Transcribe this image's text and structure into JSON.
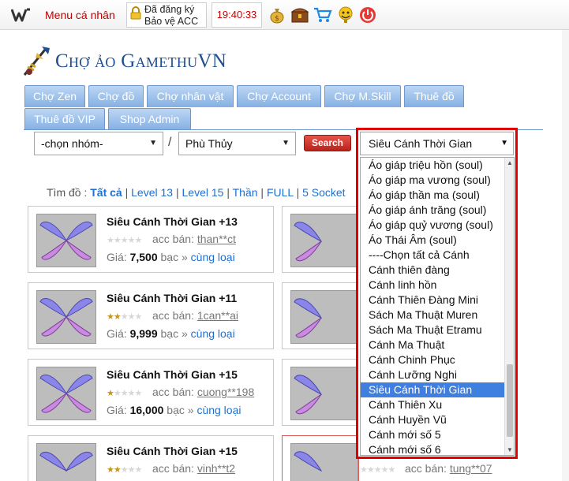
{
  "topbar": {
    "menu_label": "Menu cá nhân",
    "register_line1": "Đã đăng ký",
    "register_line2": "Bảo vệ ACC",
    "clock": "19:40:33",
    "icons": [
      "money-bag-icon",
      "chest-icon",
      "cart-icon",
      "trophy-icon",
      "power-icon"
    ]
  },
  "header": {
    "title": "Chợ ảo GamethuVN"
  },
  "tabs": [
    "Chợ Zen",
    "Chợ đồ",
    "Chợ nhân vật",
    "Chợ Account",
    "Chợ M.Skill",
    "Thuê đồ",
    "Thuê đồ VIP",
    "Shop Admin"
  ],
  "filter": {
    "group_value": "-chọn nhóm-",
    "class_value": "Phù Thủy",
    "search_label": "Search",
    "item_value": "Siêu Cánh Thời Gian"
  },
  "filter_links": {
    "prefix": "Tìm đồ :",
    "items": [
      "Tất cả",
      "Level 13",
      "Level 15",
      "Thần",
      "FULL",
      "5 Socket"
    ]
  },
  "cards": [
    {
      "name": "Siêu Cánh Thời Gian +13",
      "stars": 0,
      "seller_label": "acc bán:",
      "seller": "than**ct",
      "price_label": "Giá:",
      "price": "7,500",
      "unit": "bạc »",
      "related": "cùng loại"
    },
    {
      "name": "Siêu Cánh Thời Gian +11",
      "stars": 2,
      "seller_label": "acc bán:",
      "seller": "1can**ai",
      "price_label": "Giá:",
      "price": "9,999",
      "unit": "bạc »",
      "related": "cùng loại"
    },
    {
      "name": "Siêu Cánh Thời Gian +15",
      "stars": 1,
      "seller_label": "acc bán:",
      "seller": "cuong**198",
      "price_label": "Giá:",
      "price": "16,000",
      "unit": "bạc »",
      "related": "cùng loại"
    },
    {
      "name": "Siêu Cánh Thời Gian +15",
      "stars": 2,
      "seller_label": "acc bán:",
      "seller": "vinh**t2"
    }
  ],
  "right_card_seller": {
    "label": "acc bán:",
    "seller": "tung**07"
  },
  "dropdown": {
    "selected": "Siêu Cánh Thời Gian",
    "options": [
      "Áo giáp triệu hồn (soul)",
      "Áo giáp ma vương (soul)",
      "Áo giáp thần ma (soul)",
      "Áo giáp ánh trăng (soul)",
      "Áo giáp quỷ vương (soul)",
      "Áo Thái Âm (soul)",
      "----Chọn tất cả Cánh",
      "Cánh thiên đàng",
      "Cánh linh hồn",
      "Cánh Thiên Đàng Mini",
      "Sách Ma Thuật Muren",
      "Sách Ma Thuật Etramu",
      "Cánh Ma Thuật",
      "Cánh Chinh Phục",
      "Cánh Lưỡng Nghi",
      "Siêu Cánh Thời Gian",
      "Cánh Thiên Xu",
      "Cánh Huyền Vũ",
      "Cánh mới số 5",
      "Cánh mới số 6"
    ],
    "selected_index": 15
  }
}
